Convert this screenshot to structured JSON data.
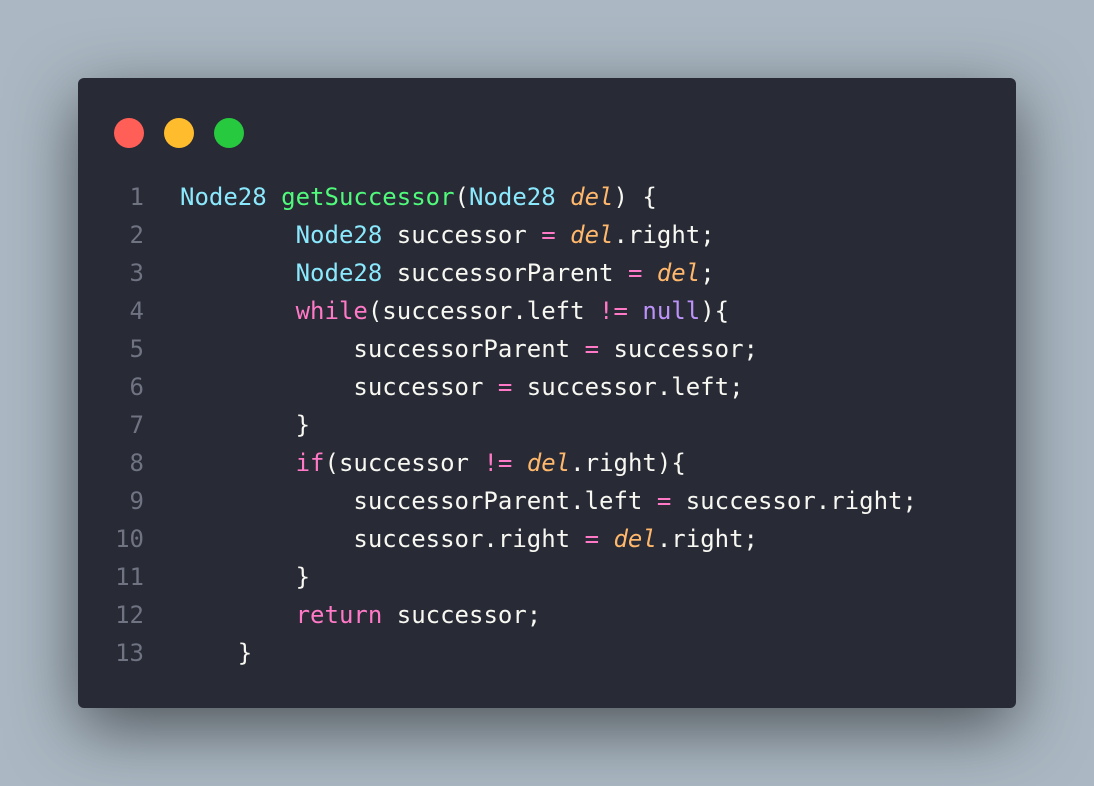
{
  "window": {
    "controls": [
      "close",
      "minimize",
      "maximize"
    ],
    "colors": {
      "close": "#ff5f56",
      "minimize": "#ffbd2e",
      "maximize": "#27c93f"
    }
  },
  "code": {
    "lines": [
      {
        "n": "1",
        "tokens": [
          {
            "t": "Node28",
            "k": "type"
          },
          {
            "t": " ",
            "k": "plain"
          },
          {
            "t": "getSuccessor",
            "k": "fn"
          },
          {
            "t": "(",
            "k": "plain"
          },
          {
            "t": "Node28",
            "k": "type"
          },
          {
            "t": " ",
            "k": "plain"
          },
          {
            "t": "del",
            "k": "param"
          },
          {
            "t": ") {",
            "k": "plain"
          }
        ]
      },
      {
        "n": "2",
        "tokens": [
          {
            "t": "        ",
            "k": "plain"
          },
          {
            "t": "Node28",
            "k": "type"
          },
          {
            "t": " successor ",
            "k": "plain"
          },
          {
            "t": "=",
            "k": "op"
          },
          {
            "t": " ",
            "k": "plain"
          },
          {
            "t": "del",
            "k": "param"
          },
          {
            "t": ".right;",
            "k": "plain"
          }
        ]
      },
      {
        "n": "3",
        "tokens": [
          {
            "t": "        ",
            "k": "plain"
          },
          {
            "t": "Node28",
            "k": "type"
          },
          {
            "t": " successorParent ",
            "k": "plain"
          },
          {
            "t": "=",
            "k": "op"
          },
          {
            "t": " ",
            "k": "plain"
          },
          {
            "t": "del",
            "k": "param"
          },
          {
            "t": ";",
            "k": "plain"
          }
        ]
      },
      {
        "n": "4",
        "tokens": [
          {
            "t": "        ",
            "k": "plain"
          },
          {
            "t": "while",
            "k": "kw"
          },
          {
            "t": "(successor.left ",
            "k": "plain"
          },
          {
            "t": "!=",
            "k": "op"
          },
          {
            "t": " ",
            "k": "plain"
          },
          {
            "t": "null",
            "k": "null"
          },
          {
            "t": "){",
            "k": "plain"
          }
        ]
      },
      {
        "n": "5",
        "tokens": [
          {
            "t": "            successorParent ",
            "k": "plain"
          },
          {
            "t": "=",
            "k": "op"
          },
          {
            "t": " successor;",
            "k": "plain"
          }
        ]
      },
      {
        "n": "6",
        "tokens": [
          {
            "t": "            successor ",
            "k": "plain"
          },
          {
            "t": "=",
            "k": "op"
          },
          {
            "t": " successor.left;",
            "k": "plain"
          }
        ]
      },
      {
        "n": "7",
        "tokens": [
          {
            "t": "        }",
            "k": "plain"
          }
        ]
      },
      {
        "n": "8",
        "tokens": [
          {
            "t": "        ",
            "k": "plain"
          },
          {
            "t": "if",
            "k": "kw"
          },
          {
            "t": "(successor ",
            "k": "plain"
          },
          {
            "t": "!=",
            "k": "op"
          },
          {
            "t": " ",
            "k": "plain"
          },
          {
            "t": "del",
            "k": "param"
          },
          {
            "t": ".right){",
            "k": "plain"
          }
        ]
      },
      {
        "n": "9",
        "tokens": [
          {
            "t": "            successorParent.left ",
            "k": "plain"
          },
          {
            "t": "=",
            "k": "op"
          },
          {
            "t": " successor.right;",
            "k": "plain"
          }
        ]
      },
      {
        "n": "10",
        "tokens": [
          {
            "t": "            successor.right ",
            "k": "plain"
          },
          {
            "t": "=",
            "k": "op"
          },
          {
            "t": " ",
            "k": "plain"
          },
          {
            "t": "del",
            "k": "param"
          },
          {
            "t": ".right;",
            "k": "plain"
          }
        ]
      },
      {
        "n": "11",
        "tokens": [
          {
            "t": "        }",
            "k": "plain"
          }
        ]
      },
      {
        "n": "12",
        "tokens": [
          {
            "t": "        ",
            "k": "plain"
          },
          {
            "t": "return",
            "k": "kw"
          },
          {
            "t": " successor;",
            "k": "plain"
          }
        ]
      },
      {
        "n": "13",
        "tokens": [
          {
            "t": "    }",
            "k": "plain"
          }
        ]
      }
    ]
  }
}
